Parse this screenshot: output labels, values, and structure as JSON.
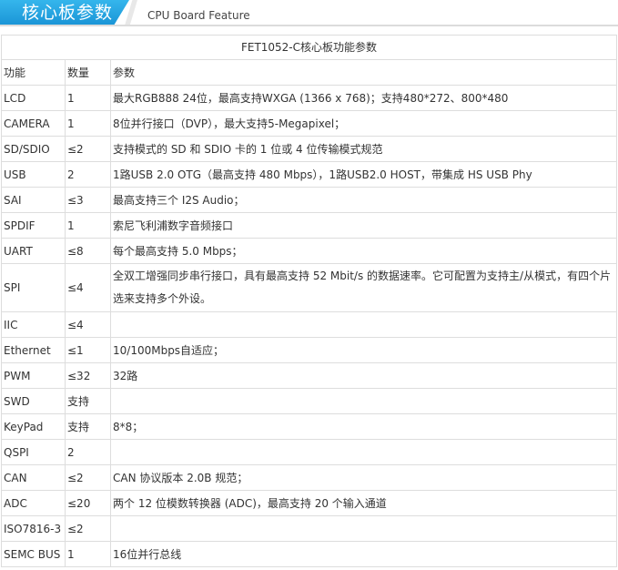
{
  "header": {
    "title": "核心板参数",
    "subtitle": "CPU Board Feature",
    "accent_color": "#1a94d6"
  },
  "table": {
    "title": "FET1052-C核心板功能参数",
    "columns": [
      "功能",
      "数量",
      "参数"
    ],
    "rows": [
      {
        "func": "LCD",
        "qty": "1",
        "param": "最大RGB888 24位，最高支持WXGA (1366 x 768)；支持480*272、800*480"
      },
      {
        "func": "CAMERA",
        "qty": "1",
        "param": "8位并行接口（DVP），最大支持5-Megapixel；"
      },
      {
        "func": "SD/SDIO",
        "qty": "≤2",
        "param": "支持模式的 SD 和 SDIO 卡的 1 位或 4 位传输模式规范"
      },
      {
        "func": "USB",
        "qty": "2",
        "param": "1路USB 2.0 OTG（最高支持 480 Mbps），1路USB2.0 HOST，带集成 HS USB Phy"
      },
      {
        "func": "SAI",
        "qty": "≤3",
        "param": "最高支持三个 I2S Audio；"
      },
      {
        "func": "SPDIF",
        "qty": "1",
        "param": "索尼飞利浦数字音频接口"
      },
      {
        "func": "UART",
        "qty": "≤8",
        "param": "每个最高支持 5.0 Mbps；"
      },
      {
        "func": "SPI",
        "qty": "≤4",
        "param": "全双工增强同步串行接口，具有最高支持 52 Mbit/s 的数据速率。它可配置为支持主/从模式，有四个片选来支持多个外设。"
      },
      {
        "func": "IIC",
        "qty": "≤4",
        "param": ""
      },
      {
        "func": "Ethernet",
        "qty": "≤1",
        "param": "10/100Mbps自适应；"
      },
      {
        "func": "PWM",
        "qty": "≤32",
        "param": "32路"
      },
      {
        "func": "SWD",
        "qty": "支持",
        "param": ""
      },
      {
        "func": "KeyPad",
        "qty": "支持",
        "param": "8*8；"
      },
      {
        "func": "QSPI",
        "qty": "2",
        "param": ""
      },
      {
        "func": "CAN",
        "qty": "≤2",
        "param": "CAN 协议版本 2.0B 规范；"
      },
      {
        "func": "ADC",
        "qty": "≤20",
        "param": "两个 12 位模数转换器 (ADC)，最高支持 20 个输入通道"
      },
      {
        "func": "ISO7816-3",
        "qty": "≤2",
        "param": ""
      },
      {
        "func": "SEMC BUS",
        "qty": "1",
        "param": "16位并行总线"
      }
    ]
  }
}
